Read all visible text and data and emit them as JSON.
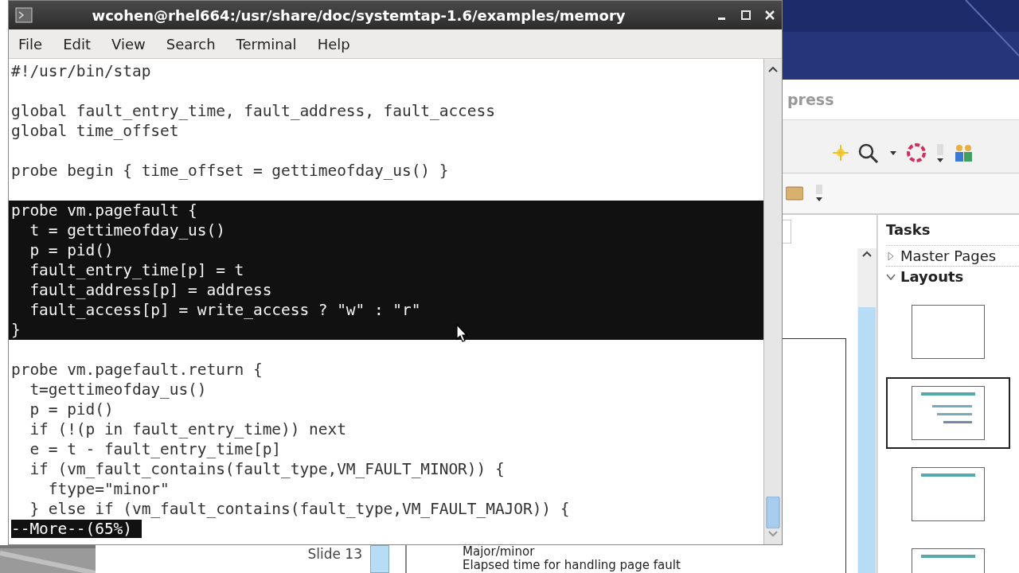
{
  "terminal": {
    "title": "wcohen@rhel664:/usr/share/doc/systemtap-1.6/examples/memory",
    "menu": [
      "File",
      "Edit",
      "View",
      "Search",
      "Terminal",
      "Help"
    ],
    "lines": [
      {
        "kind": "code",
        "text": "#!/usr/bin/stap",
        "selected": false
      },
      {
        "kind": "blank",
        "selected": false
      },
      {
        "kind": "code",
        "text": "global fault_entry_time, fault_address, fault_access",
        "selected": false
      },
      {
        "kind": "code",
        "text": "global time_offset",
        "selected": false
      },
      {
        "kind": "blank",
        "selected": false
      },
      {
        "kind": "code",
        "text": "probe begin { time_offset = gettimeofday_us() }",
        "selected": false
      },
      {
        "kind": "blank",
        "selected": false
      },
      {
        "kind": "code",
        "text": "probe vm.pagefault {",
        "selected": true
      },
      {
        "kind": "code",
        "text": "  t = gettimeofday_us()",
        "selected": true
      },
      {
        "kind": "code",
        "text": "  p = pid()",
        "selected": true
      },
      {
        "kind": "code",
        "text": "  fault_entry_time[p] = t",
        "selected": true
      },
      {
        "kind": "code",
        "text": "  fault_address[p] = address",
        "selected": true
      },
      {
        "kind": "code",
        "text": "  fault_access[p] = write_access ? \"w\" : \"r\"",
        "selected": true
      },
      {
        "kind": "code",
        "text": "}",
        "selected": true
      },
      {
        "kind": "blank",
        "selected": false
      },
      {
        "kind": "code",
        "text": "probe vm.pagefault.return {",
        "selected": false
      },
      {
        "kind": "code",
        "text": "  t=gettimeofday_us()",
        "selected": false
      },
      {
        "kind": "code",
        "text": "  p = pid()",
        "selected": false
      },
      {
        "kind": "code",
        "text": "  if (!(p in fault_entry_time)) next",
        "selected": false
      },
      {
        "kind": "code",
        "text": "  e = t - fault_entry_time[p]",
        "selected": false
      },
      {
        "kind": "code",
        "text": "  if (vm_fault_contains(fault_type,VM_FAULT_MINOR)) {",
        "selected": false
      },
      {
        "kind": "code",
        "text": "    ftype=\"minor\"",
        "selected": false
      },
      {
        "kind": "code",
        "text": "  } else if (vm_fault_contains(fault_type,VM_FAULT_MAJOR)) {",
        "selected": false
      }
    ],
    "pager": "--More--(65%)"
  },
  "impress": {
    "title_fragment": "press",
    "slide_label": "Slide 13",
    "tasks": {
      "title": "Tasks",
      "sections": [
        {
          "label": "Master Pages",
          "expanded": false
        },
        {
          "label": "Layouts",
          "expanded": true
        }
      ],
      "layouts": [
        {
          "kind": "blank",
          "selected": false
        },
        {
          "kind": "title-content",
          "selected": true
        },
        {
          "kind": "title-only",
          "selected": false
        },
        {
          "kind": "title-only",
          "selected": false
        }
      ]
    },
    "outline": [
      "Major/minor",
      "Elapsed time for handling page fault"
    ]
  }
}
